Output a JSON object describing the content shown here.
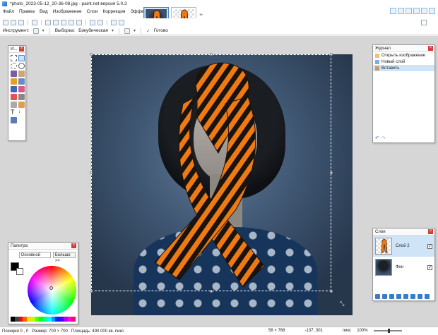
{
  "window": {
    "title": "*photo_2023-05-12_20-36-08.jpg - paint.net версия 5.0.3"
  },
  "menu": [
    "Файл",
    "Правка",
    "Вид",
    "Изображение",
    "Слои",
    "Коррекция",
    "Эффекты"
  ],
  "toolbar": {
    "tool_label": "Инструмент:",
    "sampling_label": "Выборка:",
    "sampling_value": "Бикубическая",
    "done_label": "Готово"
  },
  "history": {
    "title": "Журнал",
    "items": [
      "Открыть изображение",
      "Новый слой",
      "Вставить"
    ],
    "selected_index": 2
  },
  "layers": {
    "title": "Слои",
    "items": [
      {
        "name": "Слой 2",
        "visible": true,
        "selected": true
      },
      {
        "name": "Фон",
        "visible": true,
        "selected": false
      }
    ]
  },
  "palette": {
    "title": "Палитра",
    "preset": "Основной",
    "more_button": "Больше >>",
    "primary_color": "#000000",
    "secondary_color": "#ffffff",
    "strip": [
      "#000000",
      "#404040",
      "#ff0000",
      "#ff6a00",
      "#ffd800",
      "#b6ff00",
      "#4cff00",
      "#00ff21",
      "#00ff90",
      "#00ffff",
      "#0094ff",
      "#0026ff",
      "#4800ff",
      "#b200ff",
      "#ff00dc",
      "#ff006e"
    ]
  },
  "tools_panel": {
    "title": "И..."
  },
  "status": {
    "position": "Позиция 0 , 0",
    "size": "Размер: 700 × 700",
    "area": "Площадь: 490 000 кв. пикс.",
    "selection_size": "58 × 768",
    "cursor": "-137, 301",
    "units": "пикс",
    "zoom": "100%"
  },
  "colors": {
    "accent": "#3c8ad8",
    "ribbon_orange": "#f07a12",
    "ribbon_black": "#1a1410"
  }
}
